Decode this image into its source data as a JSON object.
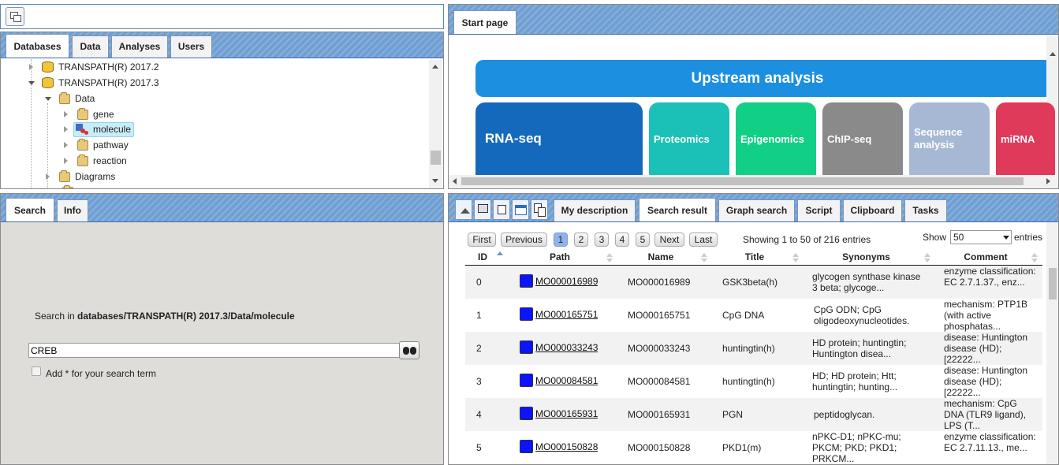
{
  "tree_panel": {
    "tabs": [
      "Databases",
      "Data",
      "Analyses",
      "Users"
    ],
    "items": [
      {
        "label": "TRANSPATH(R) 2017.2",
        "icon": "database-icon",
        "expanded": false
      },
      {
        "label": "TRANSPATH(R) 2017.3",
        "icon": "database-icon",
        "expanded": true
      },
      {
        "label": "Data",
        "icon": "folder-icon",
        "expanded": true
      },
      {
        "label": "gene",
        "icon": "folder-icon",
        "expanded": false
      },
      {
        "label": "molecule",
        "icon": "molecule-icon",
        "expanded": false,
        "selected": true
      },
      {
        "label": "pathway",
        "icon": "folder-icon",
        "expanded": false
      },
      {
        "label": "reaction",
        "icon": "folder-icon",
        "expanded": false
      },
      {
        "label": "Diagrams",
        "icon": "folder-icon",
        "expanded": false
      }
    ]
  },
  "start_panel": {
    "tab": "Start page",
    "banner": "Upstream analysis",
    "cards": [
      {
        "label": "RNA-seq",
        "color": "#1569bd"
      },
      {
        "label": "Proteomics",
        "color": "#1bc1b6"
      },
      {
        "label": "Epigenomics",
        "color": "#12cf86"
      },
      {
        "label": "ChIP-seq",
        "color": "#8a8a8a"
      },
      {
        "label": "Sequence analysis",
        "color": "#a6b8d4"
      },
      {
        "label": "miRNA",
        "color": "#e03a5a"
      }
    ]
  },
  "search_panel": {
    "tabs": [
      "Search",
      "Info"
    ],
    "search_in_prefix": "Search in ",
    "search_in_path": "databases/TRANSPATH(R) 2017.3/Data/molecule",
    "query": "CREB",
    "checkbox_label": "Add * for your search term",
    "checkbox_checked": false
  },
  "result_panel": {
    "tabs": [
      "My description",
      "Search result",
      "Graph search",
      "Script",
      "Clipboard",
      "Tasks"
    ],
    "active_tab": "Search result",
    "pagination": {
      "first": "First",
      "previous": "Previous",
      "pages": [
        "1",
        "2",
        "3",
        "4",
        "5"
      ],
      "current_page": "1",
      "next": "Next",
      "last": "Last"
    },
    "info": "Showing 1 to 50 of 216 entries",
    "show_label": "Show",
    "page_size": "50",
    "entries_label": "entries",
    "columns": [
      "ID",
      "Path",
      "Name",
      "Title",
      "Synonyms",
      "Comment"
    ],
    "rows": [
      {
        "id": "0",
        "path": "MO000016989",
        "name": "MO000016989",
        "title": "GSK3beta(h)",
        "synonyms": "glycogen synthase kinase 3 beta; glycoge...",
        "comment": "enzyme classification: EC 2.7.1.37., enz..."
      },
      {
        "id": "1",
        "path": "MO000165751",
        "name": "MO000165751",
        "title": "CpG DNA",
        "synonyms": "CpG ODN; CpG oligodeoxynucleotides.",
        "comment": "mechanism: PTP1B (with active phosphatas..."
      },
      {
        "id": "2",
        "path": "MO000033243",
        "name": "MO000033243",
        "title": "huntingtin(h)",
        "synonyms": "HD protein; huntingtin; Huntington disea...",
        "comment": "disease: Huntington disease (HD); [22222..."
      },
      {
        "id": "3",
        "path": "MO000084581",
        "name": "MO000084581",
        "title": "huntingtin(h)",
        "synonyms": "HD; HD protein; Htt; huntingtin; hunting...",
        "comment": "disease: Huntington disease (HD); [22222..."
      },
      {
        "id": "4",
        "path": "MO000165931",
        "name": "MO000165931",
        "title": "PGN",
        "synonyms": "peptidoglycan.",
        "comment": "mechanism: CpG DNA (TLR9 ligand), LPS (T..."
      },
      {
        "id": "5",
        "path": "MO000150828",
        "name": "MO000150828",
        "title": "PKD1(m)",
        "synonyms": "nPKC-D1; nPKC-mu; PKCM; PKD; PKD1; PRKCM...",
        "comment": "enzyme classification: EC 2.7.11.13., me..."
      }
    ]
  }
}
